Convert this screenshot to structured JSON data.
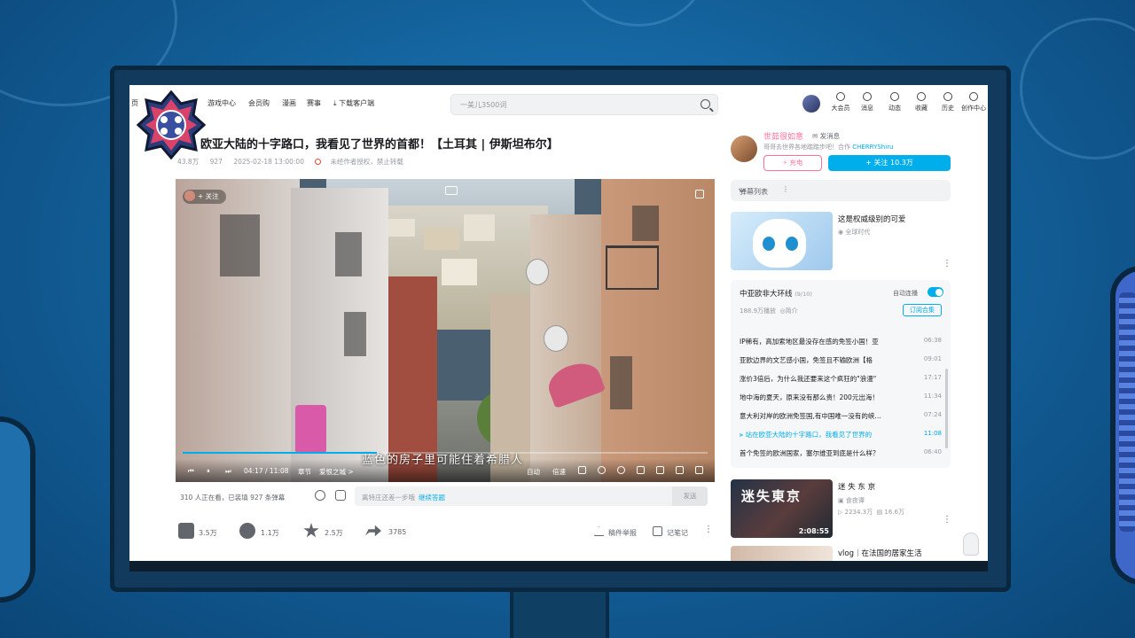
{
  "nav": {
    "left_items": [
      "页",
      "游戏中心",
      "会员购",
      "漫画",
      "赛事",
      "下载客户端"
    ],
    "search_placeholder": "一美儿3500词",
    "right_items": [
      "大会员",
      "消息",
      "动态",
      "收藏",
      "历史",
      "创作中心"
    ]
  },
  "video": {
    "title": "欧亚大陆的十字路口，我看见了世界的首都！【土耳其 | 伊斯坦布尔】",
    "meta": {
      "views": "43.8万",
      "danmaku_count": "927",
      "date": "2025-02-18 13:00:00",
      "notice": "未经作者授权，禁止转载"
    },
    "uploader_badge": "+ 关注",
    "subtitle": "蓝色的房子里可能住着希腊人",
    "progress": 0.37,
    "controls": {
      "time": "04:17 / 11:08",
      "chapter": "章节",
      "chapter_name": "爱恨之城 >",
      "auto": "自动",
      "speed": "倍速"
    }
  },
  "danmaku_bar": {
    "watching": "310 人正在看，已装填 927 条弹幕",
    "input_placeholder": "离特庄还差一步哦",
    "input_link": "继续答题",
    "send": "发送"
  },
  "actions": {
    "like": "3.5万",
    "coin": "1.1万",
    "fav": "2.5万",
    "share": "3785",
    "report": "稿件举报",
    "notes": "记笔记"
  },
  "uploader": {
    "name": "世茹很如意",
    "message": "发消息",
    "desc_prefix": "哥哥去世界各地踏踏步吧！合作 ",
    "desc_contact": "CHERRYShiru",
    "charge": "充电",
    "follow": "+ 关注 10.3万"
  },
  "danmaku_list": {
    "label": "弹幕列表"
  },
  "ad": {
    "title": "这是权威级别的可爱",
    "sub": "全球时代"
  },
  "playlist": {
    "title": "中亚欧非大环线",
    "count": "(9/10)",
    "autoplay": "自动连播",
    "views": "188.9万播放",
    "intro": "简介",
    "subscribe": "订阅合集",
    "items": [
      {
        "title": "IP稀有，高加索地区最没存在感的免签小国！亚",
        "duration": "06:38"
      },
      {
        "title": "亚欧边界的文艺感小国，免签且不输欧洲【格",
        "duration": "09:01"
      },
      {
        "title": "涨价3倍后，为什么我还要来这个疯狂的\"浪漫\"",
        "duration": "17:17"
      },
      {
        "title": "地中海的夏天，原来没有那么贵！200元出海！",
        "duration": "11:34"
      },
      {
        "title": "意大利对岸的欧洲免签国,有中国唯一没有的峡…",
        "duration": "07:24"
      },
      {
        "title": "站在欧亚大陆的十字路口，我看见了世界的",
        "duration": "11:08"
      },
      {
        "title": "首个免签的欧洲国家，塞尔维亚到底是什么样？",
        "duration": "06:40"
      }
    ]
  },
  "recommend": [
    {
      "thumb_title": "迷失東京",
      "duration": "2:08:55",
      "title": "迷 失 东 京",
      "up": "食夜谭",
      "plays": "2234.3万",
      "danmaku": "16.6万"
    },
    {
      "title": "vlog｜在法国的居家生活"
    }
  ],
  "colors": {
    "accent": "#00aeec",
    "pink": "#fb7299",
    "bg": "#125d96"
  }
}
